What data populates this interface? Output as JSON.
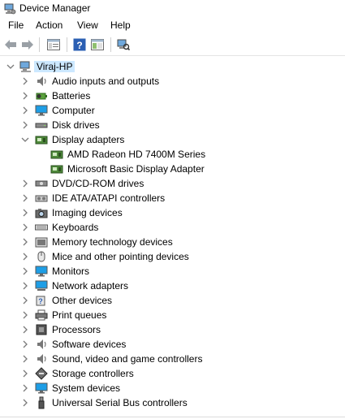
{
  "window": {
    "title": "Device Manager"
  },
  "menu": [
    "File",
    "Action",
    "View",
    "Help"
  ],
  "toolbar": {
    "buttons": [
      "back-icon",
      "forward-icon",
      "properties-icon",
      "help-icon",
      "show-hide-console-tree-icon",
      "scan-hardware-icon"
    ]
  },
  "tree": {
    "root": {
      "label": "Viraj-HP",
      "icon": "computer-icon",
      "expanded": true
    },
    "categories": [
      {
        "label": "Audio inputs and outputs",
        "icon": "speaker-icon"
      },
      {
        "label": "Batteries",
        "icon": "battery-icon"
      },
      {
        "label": "Computer",
        "icon": "monitor-icon"
      },
      {
        "label": "Disk drives",
        "icon": "disk-drive-icon"
      },
      {
        "label": "Display adapters",
        "icon": "display-adapter-icon",
        "expanded": true,
        "children": [
          {
            "label": "AMD Radeon HD 7400M Series",
            "icon": "display-adapter-icon"
          },
          {
            "label": "Microsoft Basic Display Adapter",
            "icon": "display-adapter-icon"
          }
        ]
      },
      {
        "label": "DVD/CD-ROM drives",
        "icon": "cd-drive-icon"
      },
      {
        "label": "IDE ATA/ATAPI controllers",
        "icon": "ide-controller-icon"
      },
      {
        "label": "Imaging devices",
        "icon": "camera-icon"
      },
      {
        "label": "Keyboards",
        "icon": "keyboard-icon"
      },
      {
        "label": "Memory technology devices",
        "icon": "memory-icon"
      },
      {
        "label": "Mice and other pointing devices",
        "icon": "mouse-icon"
      },
      {
        "label": "Monitors",
        "icon": "monitor-icon"
      },
      {
        "label": "Network adapters",
        "icon": "network-icon"
      },
      {
        "label": "Other devices",
        "icon": "unknown-device-icon"
      },
      {
        "label": "Print queues",
        "icon": "printer-icon"
      },
      {
        "label": "Processors",
        "icon": "processor-icon"
      },
      {
        "label": "Software devices",
        "icon": "speaker-icon"
      },
      {
        "label": "Sound, video and game controllers",
        "icon": "speaker-icon"
      },
      {
        "label": "Storage controllers",
        "icon": "storage-controller-icon"
      },
      {
        "label": "System devices",
        "icon": "monitor-icon"
      },
      {
        "label": "Universal Serial Bus controllers",
        "icon": "usb-icon"
      }
    ]
  },
  "colors": {
    "selection": "#cce8ff",
    "chevron": "#7a7a7a",
    "accent": "#1979ca"
  }
}
